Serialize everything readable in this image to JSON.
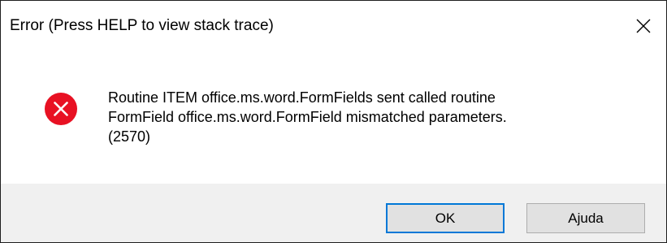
{
  "dialog": {
    "title": "Error (Press HELP to view stack trace)",
    "close_icon": "close-icon",
    "error_icon": "error-icon",
    "error_color": "#e81123",
    "message_lines": [
      "Routine ITEM office.ms.word.FormFields sent called routine",
      "FormField office.ms.word.FormField mismatched parameters.",
      "(2570)"
    ],
    "buttons": {
      "ok_label": "OK",
      "help_label": "Ajuda"
    },
    "accent_color": "#0078d7"
  }
}
